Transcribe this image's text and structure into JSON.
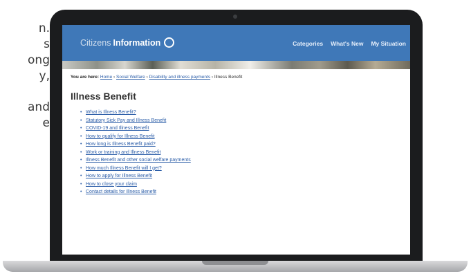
{
  "side_text": {
    "lines": [
      "n.",
      "s",
      "ong",
      "y,",
      "",
      "and",
      "e"
    ]
  },
  "site": {
    "logo_light": "Citizens",
    "logo_bold": "Information",
    "nav": [
      "Categories",
      "What's New",
      "My Situation"
    ]
  },
  "breadcrumb": {
    "prefix": "You are here:",
    "items": [
      "Home",
      "Social Welfare",
      "Disability and illness payments"
    ],
    "current": "Illness Benefit"
  },
  "page_title": "Illness Benefit",
  "links": [
    "What is Illness Benefit?",
    "Statutory Sick Pay and Illness Benefit",
    "COVID-19 and Illness Benefit",
    "How to qualify for Illness Benefit",
    "How long is Illness Benefit paid?",
    "Work or training and Illness Benefit",
    "Illness Benefit and other social welfare payments",
    "How much Illness Benefit will I get?",
    "How to apply for Illness Benefit",
    "How to close your claim",
    "Contact details for Illness Benefit"
  ]
}
